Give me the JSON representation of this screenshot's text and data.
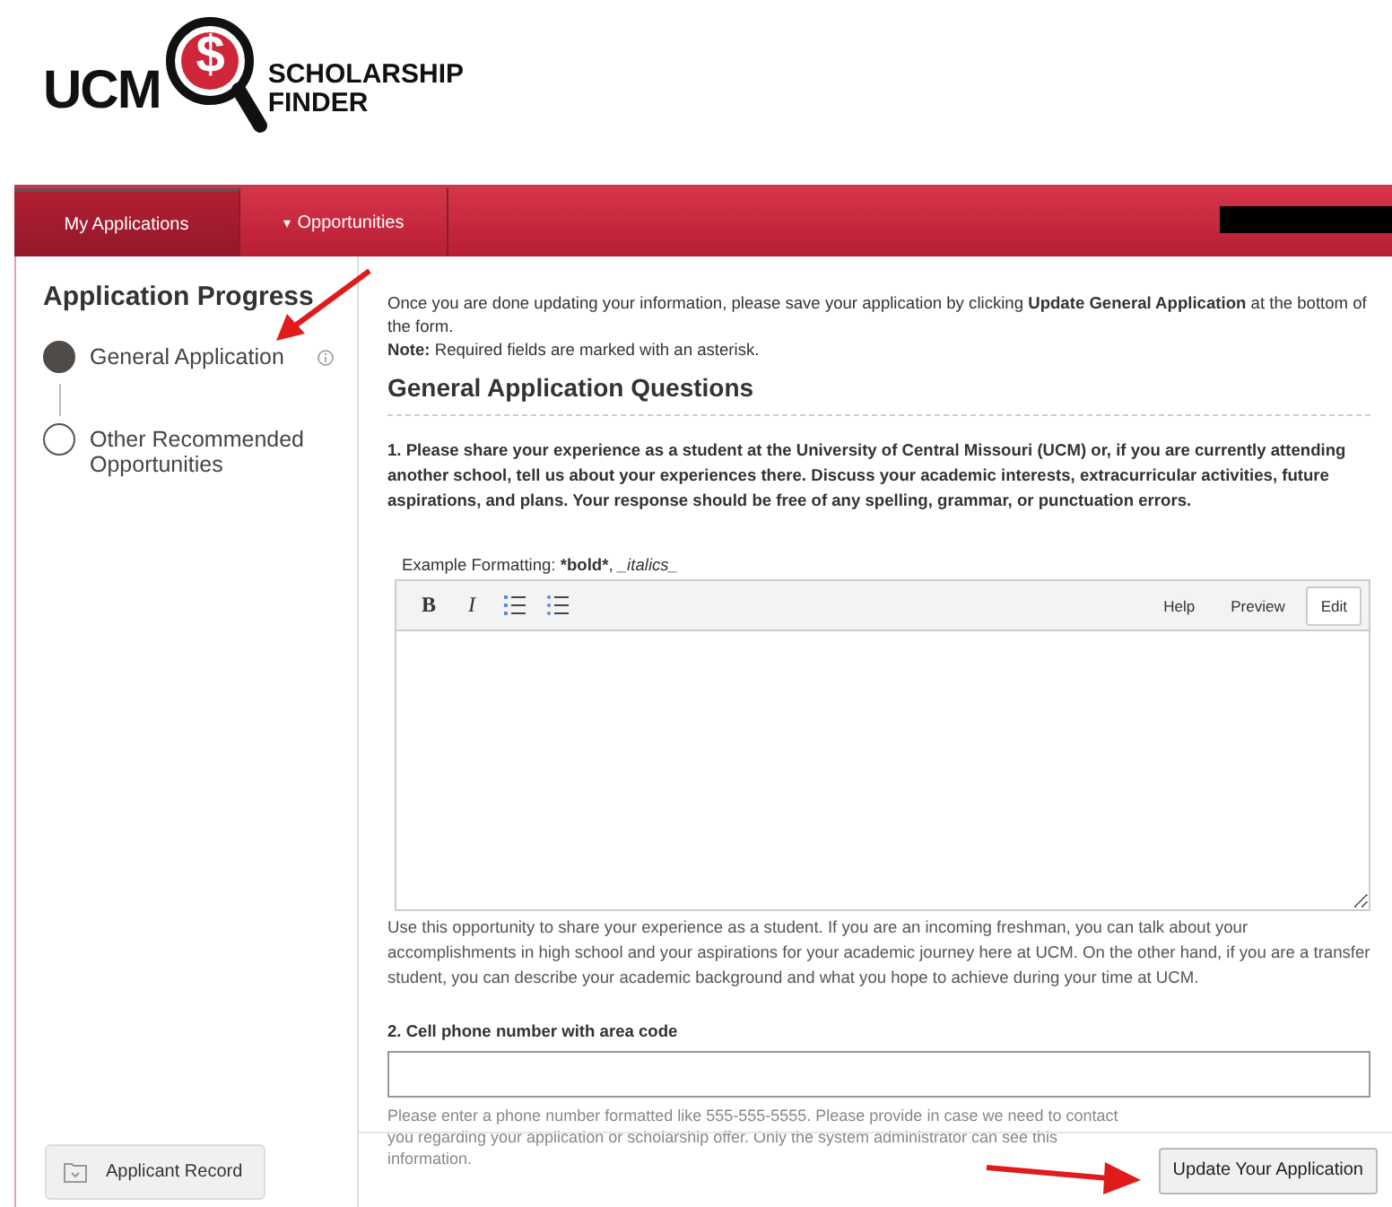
{
  "logo": {
    "wordmark": "UCM",
    "symbol": "$",
    "title_line_1": "SCHOLARSHIP",
    "title_line_2": "FINDER"
  },
  "nav": {
    "tabs": [
      {
        "label": "My Applications",
        "selected": true
      },
      {
        "label": "Opportunities",
        "selected": false,
        "icon": "▾"
      }
    ]
  },
  "sidebar": {
    "title": "Application Progress",
    "steps": [
      {
        "label": "General Application",
        "completed": true,
        "info": true
      },
      {
        "label": "Other Recommended Opportunities",
        "completed": false,
        "info": false
      }
    ],
    "record_button": "Applicant Record"
  },
  "intro": "Once you are done updating your information, please save your application by clicking **Update General Application** at the bottom of the form.",
  "note": "**Note:** Required fields are marked with an asterisk.",
  "section_title": "General Application Questions",
  "questions": [
    {
      "kind": "richtext",
      "prompt": "1. Please share your experience as a student at the University of Central Missouri (UCM) or, if you are currently attending another school, tell us about your experiences there. Discuss your academic interests, extracurricular activities, future aspirations, and plans. Your response should be free of any spelling, grammar, or punctuation errors.",
      "format_label": "Example Formatting:",
      "bold_sample": "*bold*",
      "separator": ",",
      "italic_sample": "_italics_",
      "format_buttons": [
        {
          "kind": "bold",
          "label": "B"
        },
        {
          "kind": "italic",
          "label": "I"
        },
        {
          "kind": "ordered-list"
        },
        {
          "kind": "bullet-list"
        }
      ],
      "modes": [
        {
          "label": "Help",
          "selected": false
        },
        {
          "label": "Preview",
          "selected": false
        },
        {
          "label": "Edit",
          "selected": true
        }
      ],
      "help": "Use this opportunity to share your experience as a student. If you are an incoming freshman, you can talk about your accomplishments in high school and your aspirations for your academic journey here at UCM. On the other hand, if you are a transfer student, you can describe your academic background and what you hope to achieve during your time at UCM."
    },
    {
      "kind": "text",
      "prompt": "2. Cell phone number with area code",
      "help": "Please enter a phone number formatted like 555-555-5555. Please provide in case we need to contact you regarding your application or scholarship offer. Only the system administrator can see this information."
    }
  ],
  "submit_button": "Update Your Application"
}
